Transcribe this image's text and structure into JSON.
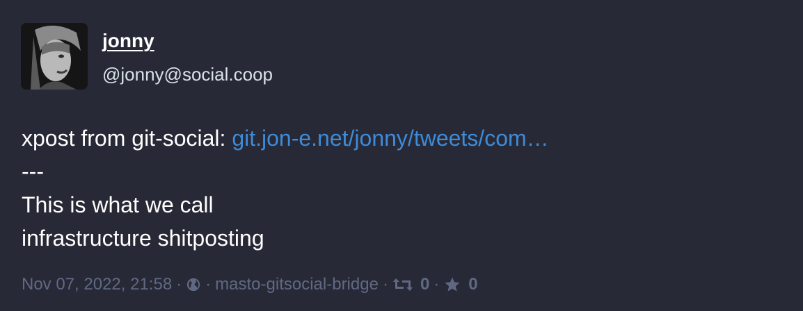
{
  "status": {
    "author": {
      "display_name": "jonny",
      "handle": "@jonny@social.coop",
      "avatar_icon": "avatar-photo"
    },
    "content": {
      "prefix": "xpost from git-social: ",
      "link_text": "git.jon-e.net/jonny/tweets/com…",
      "separator": "---",
      "lines": [
        "This is what we call",
        "infrastructure shitposting"
      ]
    },
    "meta": {
      "timestamp": "Nov 07, 2022, 21:58",
      "dot": "·",
      "visibility_icon": "globe-icon",
      "application": "masto-gitsocial-bridge",
      "boost_icon": "retweet-icon",
      "boost_count": "0",
      "favourite_icon": "star-icon",
      "favourite_count": "0"
    }
  },
  "colors": {
    "background": "#282936",
    "text": "#ffffff",
    "secondary_text": "#d9e1e8",
    "muted": "#606984",
    "link": "#3e8bd8"
  }
}
